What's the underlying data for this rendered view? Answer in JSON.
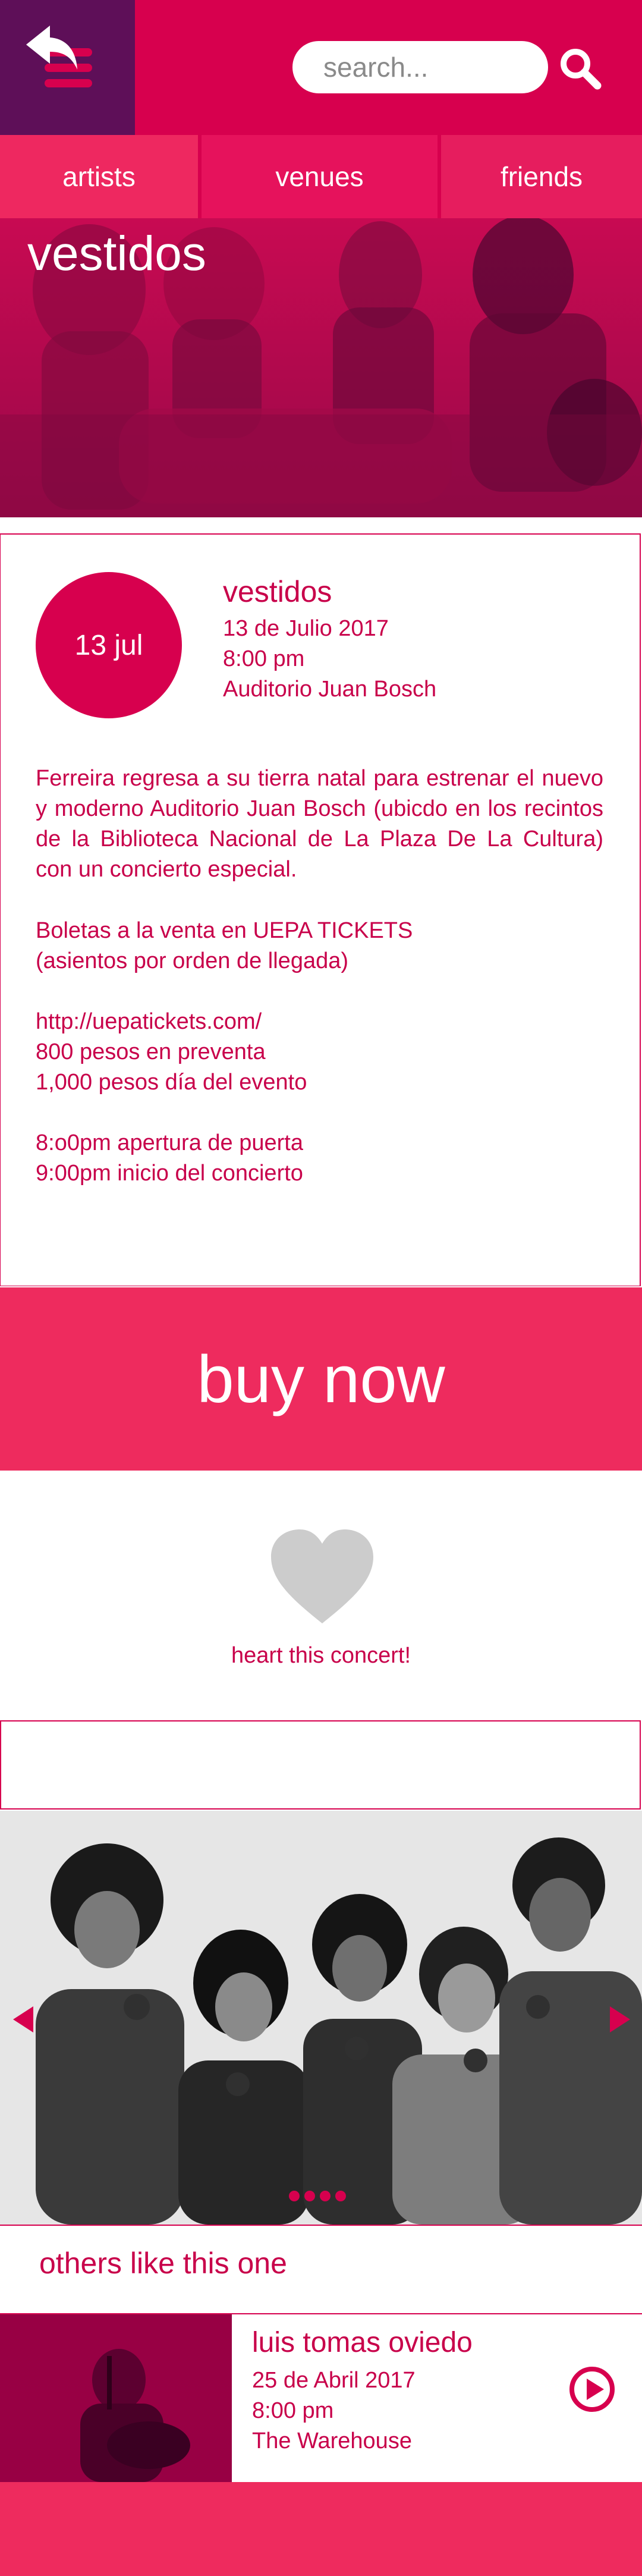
{
  "header": {
    "menu_icon": "hamburger-menu-icon",
    "search_placeholder": "search...",
    "search_icon": "search-icon",
    "colors": {
      "primary": "#d7004e",
      "menu_bg": "#5e0f58",
      "accent": "#ee2b5e"
    }
  },
  "tabs": [
    {
      "label": "artists"
    },
    {
      "label": "venues"
    },
    {
      "label": "friends"
    }
  ],
  "hero": {
    "title": "vestidos",
    "back_icon": "back-arrow-icon"
  },
  "event": {
    "date_badge": "13 jul",
    "title": "vestidos",
    "date": "13 de Julio 2017",
    "time": "8:00 pm",
    "venue": "Auditorio Juan Bosch",
    "description": "Ferreira regresa a su tierra natal para estrenar el nuevo y moderno Auditorio Juan Bosch (ubicdo en los recintos de la Biblioteca Nacional de La Plaza De La Cultura) con un concierto especial.",
    "tickets_line1": "Boletas a la venta en UEPA TICKETS",
    "tickets_line2": "(asientos por orden de llegada)",
    "link": "http://uepatickets.com/",
    "presale": "800 pesos en preventa",
    "door_price": "1,000 pesos día del evento",
    "doors_open": "8:o0pm apertura de puerta",
    "show_start": "9:00pm inicio del concierto"
  },
  "buy": {
    "label": "buy now"
  },
  "heart": {
    "label": "heart this concert!",
    "icon": "heart-icon"
  },
  "gallery": {
    "slide_count": 4,
    "active_slide": 1
  },
  "others": {
    "title": "others like this one",
    "items": [
      {
        "name": "luis tomas oviedo",
        "date": "25 de Abril 2017",
        "time": "8:00 pm",
        "venue": "The Warehouse",
        "icon": "play-icon"
      }
    ]
  }
}
